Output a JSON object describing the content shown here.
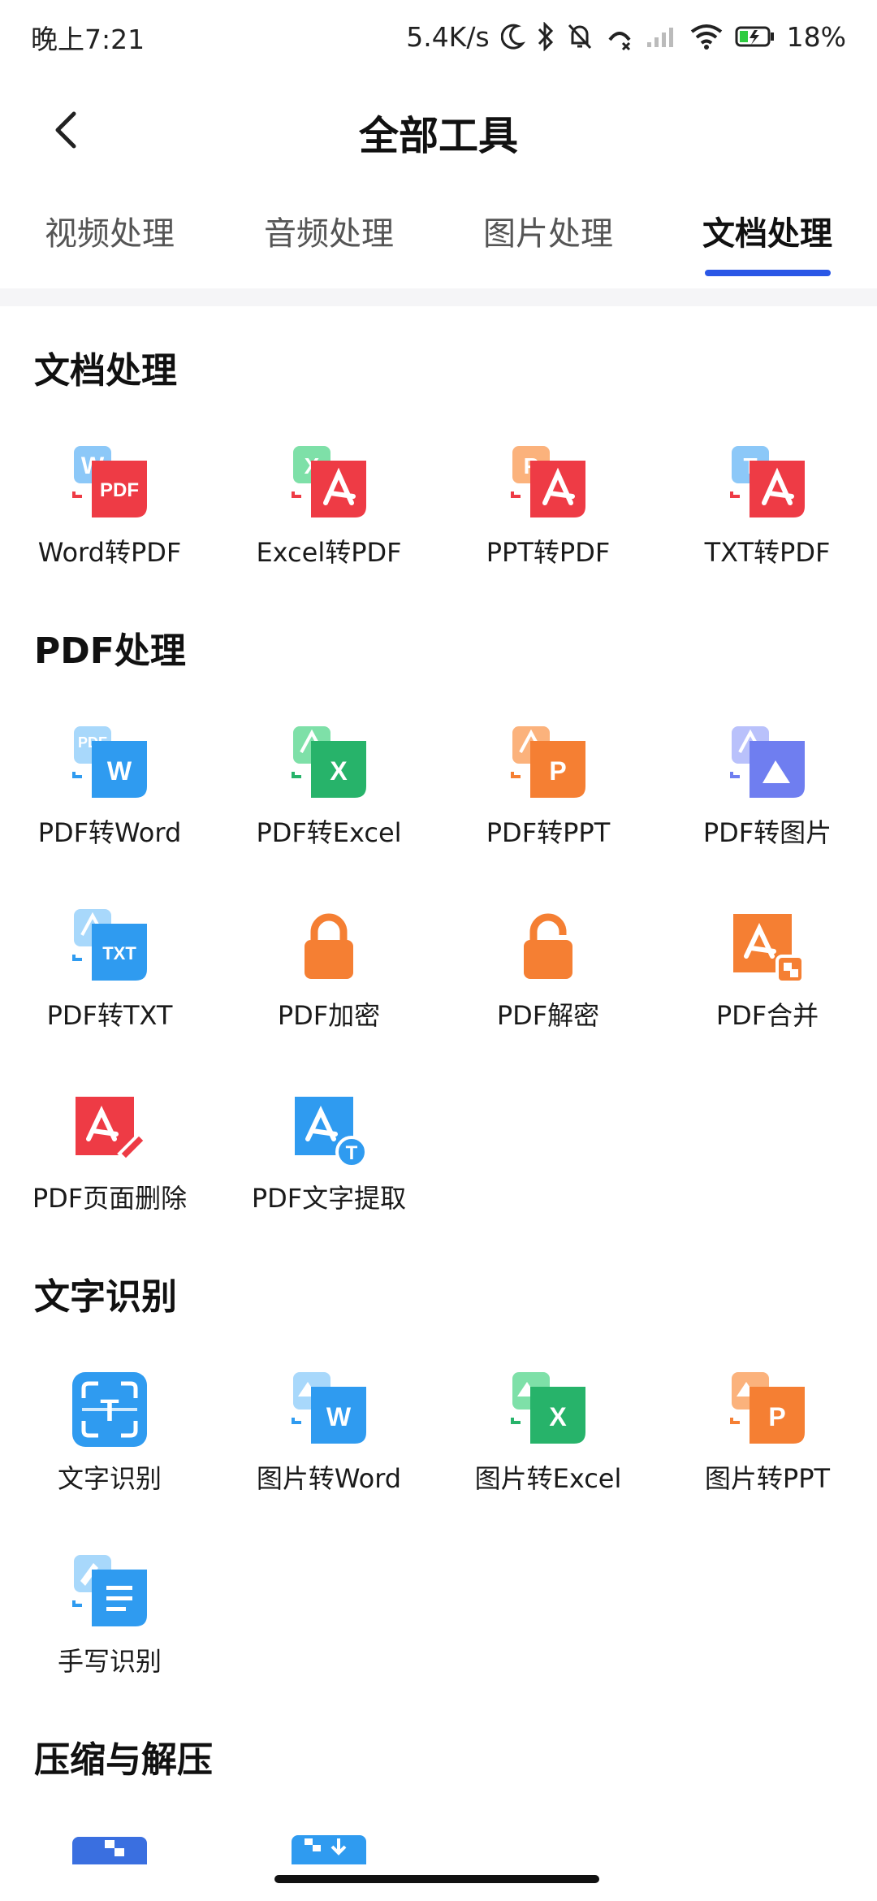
{
  "status": {
    "time": "晚上7:21",
    "net_speed": "5.4K/s",
    "battery": "18%"
  },
  "header": {
    "title": "全部工具"
  },
  "tabs": [
    {
      "label": "视频处理"
    },
    {
      "label": "音频处理"
    },
    {
      "label": "图片处理"
    },
    {
      "label": "文档处理",
      "active": true
    }
  ],
  "sections": [
    {
      "title": "文档处理",
      "tools": [
        {
          "label": "Word转PDF",
          "icon": "word-to-pdf-icon",
          "badge": "PDF"
        },
        {
          "label": "Excel转PDF",
          "icon": "excel-to-pdf-icon"
        },
        {
          "label": "PPT转PDF",
          "icon": "ppt-to-pdf-icon"
        },
        {
          "label": "TXT转PDF",
          "icon": "txt-to-pdf-icon"
        }
      ]
    },
    {
      "title": "PDF处理",
      "tools": [
        {
          "label": "PDF转Word",
          "icon": "pdf-to-word-icon",
          "badge": "W"
        },
        {
          "label": "PDF转Excel",
          "icon": "pdf-to-excel-icon",
          "badge": "X"
        },
        {
          "label": "PDF转PPT",
          "icon": "pdf-to-ppt-icon",
          "badge": "P"
        },
        {
          "label": "PDF转图片",
          "icon": "pdf-to-image-icon"
        },
        {
          "label": "PDF转TXT",
          "icon": "pdf-to-txt-icon",
          "badge": "TXT"
        },
        {
          "label": "PDF加密",
          "icon": "lock-icon"
        },
        {
          "label": "PDF解密",
          "icon": "unlock-icon"
        },
        {
          "label": "PDF合并",
          "icon": "pdf-merge-icon"
        },
        {
          "label": "PDF页面删除",
          "icon": "pdf-page-delete-icon"
        },
        {
          "label": "PDF文字提取",
          "icon": "pdf-text-extract-icon",
          "badge": "T"
        }
      ]
    },
    {
      "title": "文字识别",
      "tools": [
        {
          "label": "文字识别",
          "icon": "text-scan-icon",
          "badge": "T"
        },
        {
          "label": "图片转Word",
          "icon": "image-to-word-icon",
          "badge": "W"
        },
        {
          "label": "图片转Excel",
          "icon": "image-to-excel-icon",
          "badge": "X"
        },
        {
          "label": "图片转PPT",
          "icon": "image-to-ppt-icon",
          "badge": "P"
        },
        {
          "label": "手写识别",
          "icon": "handwriting-icon"
        }
      ]
    },
    {
      "title": "压缩与解压",
      "tools": []
    }
  ],
  "colors": {
    "accent": "#2a57e6",
    "pdf_red": "#ee3b45",
    "word_blue": "#2f9bf0",
    "excel_green": "#27b36a",
    "ppt_orange": "#f57f33",
    "purple": "#6f7ef0"
  }
}
